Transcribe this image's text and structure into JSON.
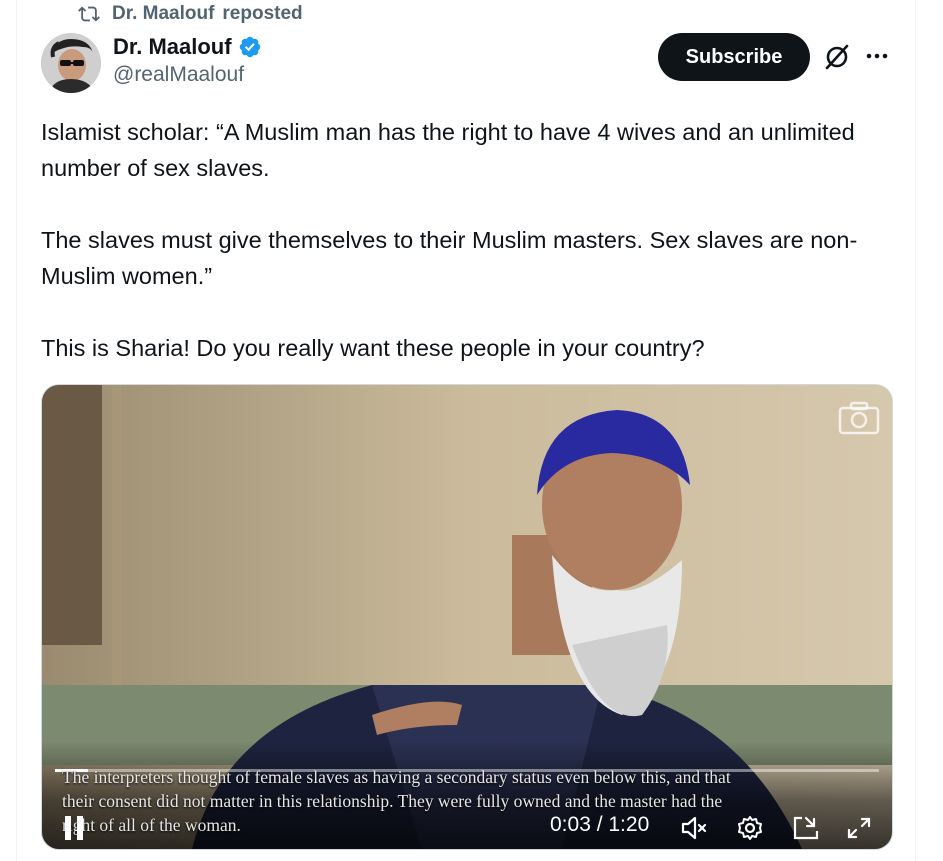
{
  "repost": {
    "label": "Dr. Maalouf",
    "suffix": "reposted",
    "icon": "repost-icon"
  },
  "author": {
    "display_name": "Dr. Maalouf",
    "handle": "@realMaalouf",
    "verified_color": "#1d9bf0"
  },
  "header": {
    "subscribe_label": "Subscribe",
    "grok_icon": "grok-icon",
    "more_icon": "more-icon"
  },
  "tweet": {
    "paragraphs": [
      "Islamist scholar: “A Muslim man has the right to have 4 wives and an unlimited number of sex slaves.",
      "The slaves must give themselves to their Muslim masters. Sex slaves are non-Muslim women.”",
      "This is Sharia! Do you really want these people in your country?"
    ]
  },
  "video": {
    "subtitle_lines": [
      "The interpreters thought of female slaves as having a secondary status even below this, and that",
      "their consent did not matter in this relationship. They were fully owned and the master had the",
      "right of all of the woman."
    ],
    "time": "0:03 / 1:20",
    "progress_fraction": 0.04,
    "icons": [
      "camera-icon",
      "pause-icon",
      "muted-speaker-icon",
      "settings-gear-icon",
      "pop-out-icon",
      "fullscreen-icon"
    ]
  }
}
